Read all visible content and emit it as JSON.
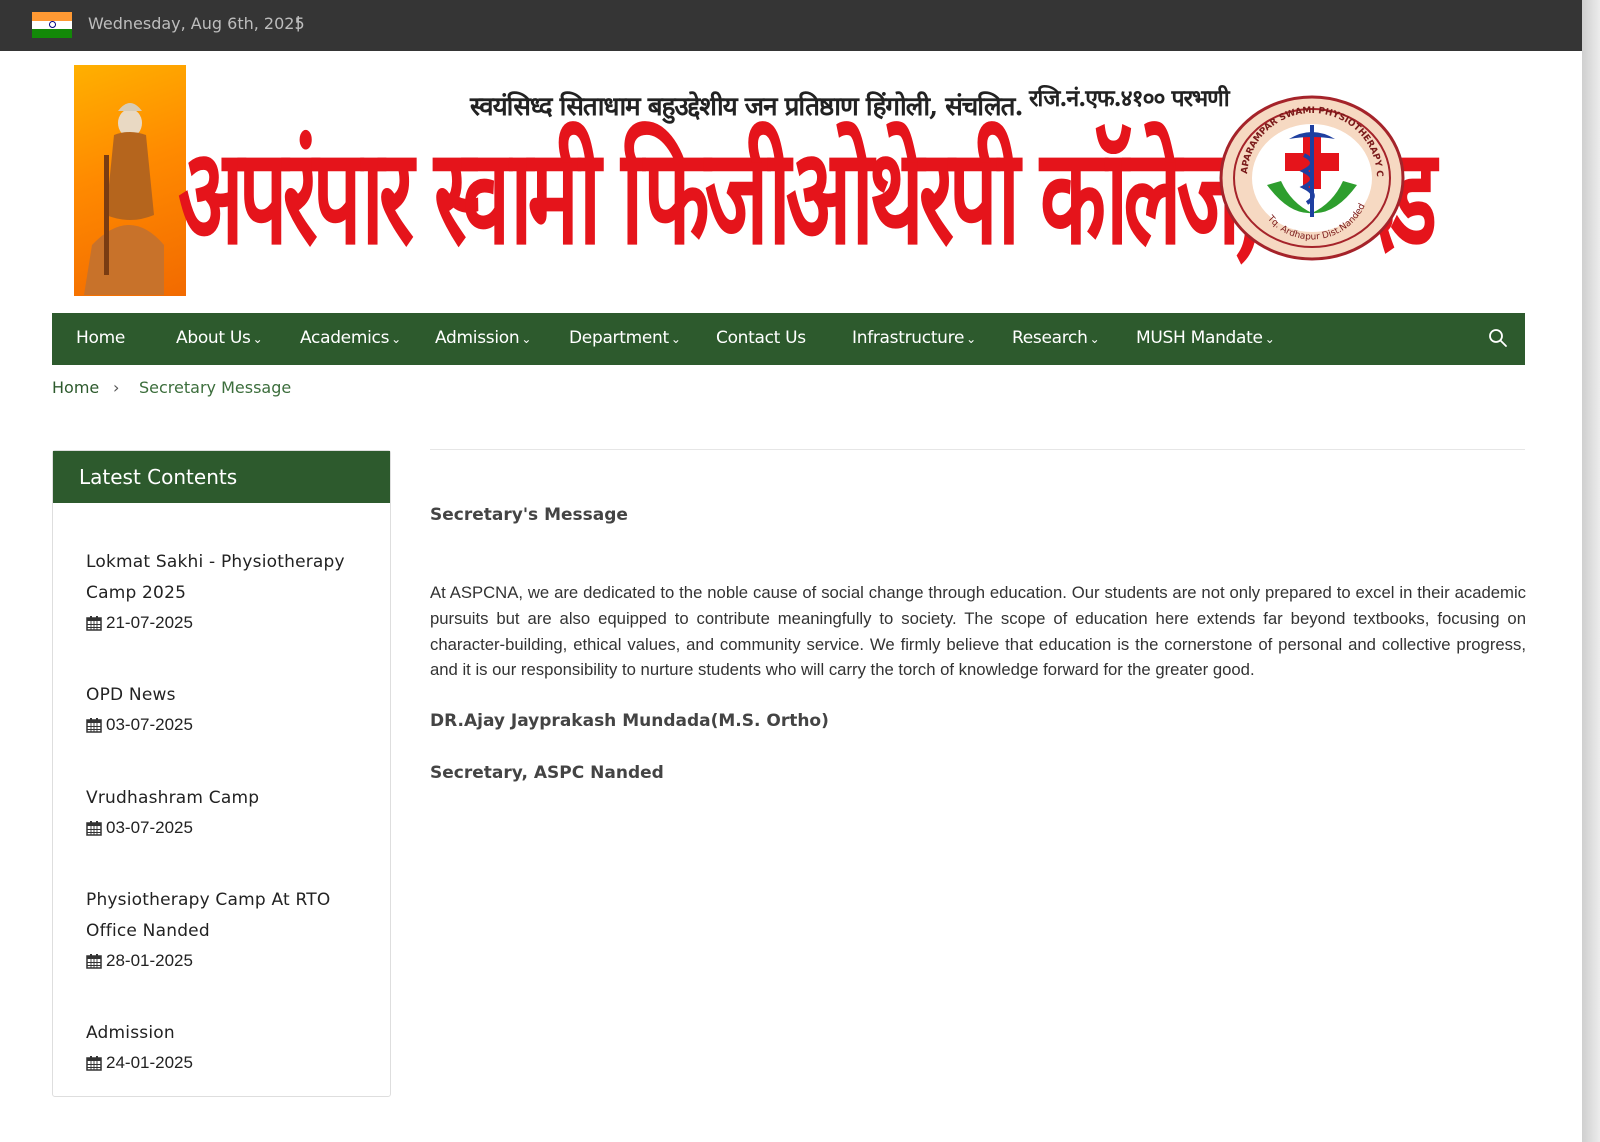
{
  "topbar": {
    "flag_icon": "india-flag-icon",
    "date": "Wednesday, Aug 6th, 2025",
    "separator": "|"
  },
  "banner": {
    "subtitle": "स्वयंसिध्द सिताधाम बहुउद्देशीय जन प्रतिष्ठाण हिंगोली, संचलित.",
    "registration": "रजि.नं.एफ.४१०० परभणी",
    "title": "अपरंपार स्वामी फिजीओथेरपी कॉलेज, नांदेड",
    "seal_ring_text": "APARAMPAR SWAMI PHYSIOTHERAPY COLLEGE, JAMBHRUN",
    "seal_bottom_text": "Tq. Ardhapur Dist.Nanded",
    "title_color": "#e5141b"
  },
  "nav": {
    "items": [
      {
        "label": "Home",
        "dropdown": false
      },
      {
        "label": "About Us",
        "dropdown": true
      },
      {
        "label": "Academics",
        "dropdown": true
      },
      {
        "label": "Admission",
        "dropdown": true
      },
      {
        "label": "Department",
        "dropdown": true
      },
      {
        "label": "Contact Us",
        "dropdown": false
      },
      {
        "label": "Infrastructure",
        "dropdown": true
      },
      {
        "label": "Research",
        "dropdown": true
      },
      {
        "label": "MUSH Mandate",
        "dropdown": true
      }
    ],
    "search_icon": "search-icon",
    "background": "#2d5a2d"
  },
  "breadcrumb": {
    "home": "Home",
    "separator": "›",
    "current": "Secretary Message"
  },
  "sidebar": {
    "title": "Latest Contents",
    "posts": [
      {
        "title": "Lokmat Sakhi - Physiotherapy Camp 2025",
        "date": "21-07-2025"
      },
      {
        "title": "OPD News",
        "date": "03-07-2025"
      },
      {
        "title": "Vrudhashram Camp",
        "date": "03-07-2025"
      },
      {
        "title": "Physiotherapy Camp At RTO Office Nanded",
        "date": "28-01-2025"
      },
      {
        "title": "Admission",
        "date": "24-01-2025"
      }
    ]
  },
  "content": {
    "heading": "Secretary's Message",
    "paragraph": "At ASPCNA, we are dedicated to the noble cause of social change through education. Our students are not only prepared to excel in their academic pursuits but are also equipped to contribute meaningfully to society. The scope of education here extends far beyond textbooks, focusing on character-building, ethical values, and community service. We firmly believe that education is the cornerstone of personal and collective progress, and it is our responsibility to nurture students who will carry the torch of knowledge forward for the greater good.",
    "name": "DR.Ajay Jayprakash Mundada(M.S. Ortho)",
    "role": "Secretary, ASPC Nanded"
  }
}
